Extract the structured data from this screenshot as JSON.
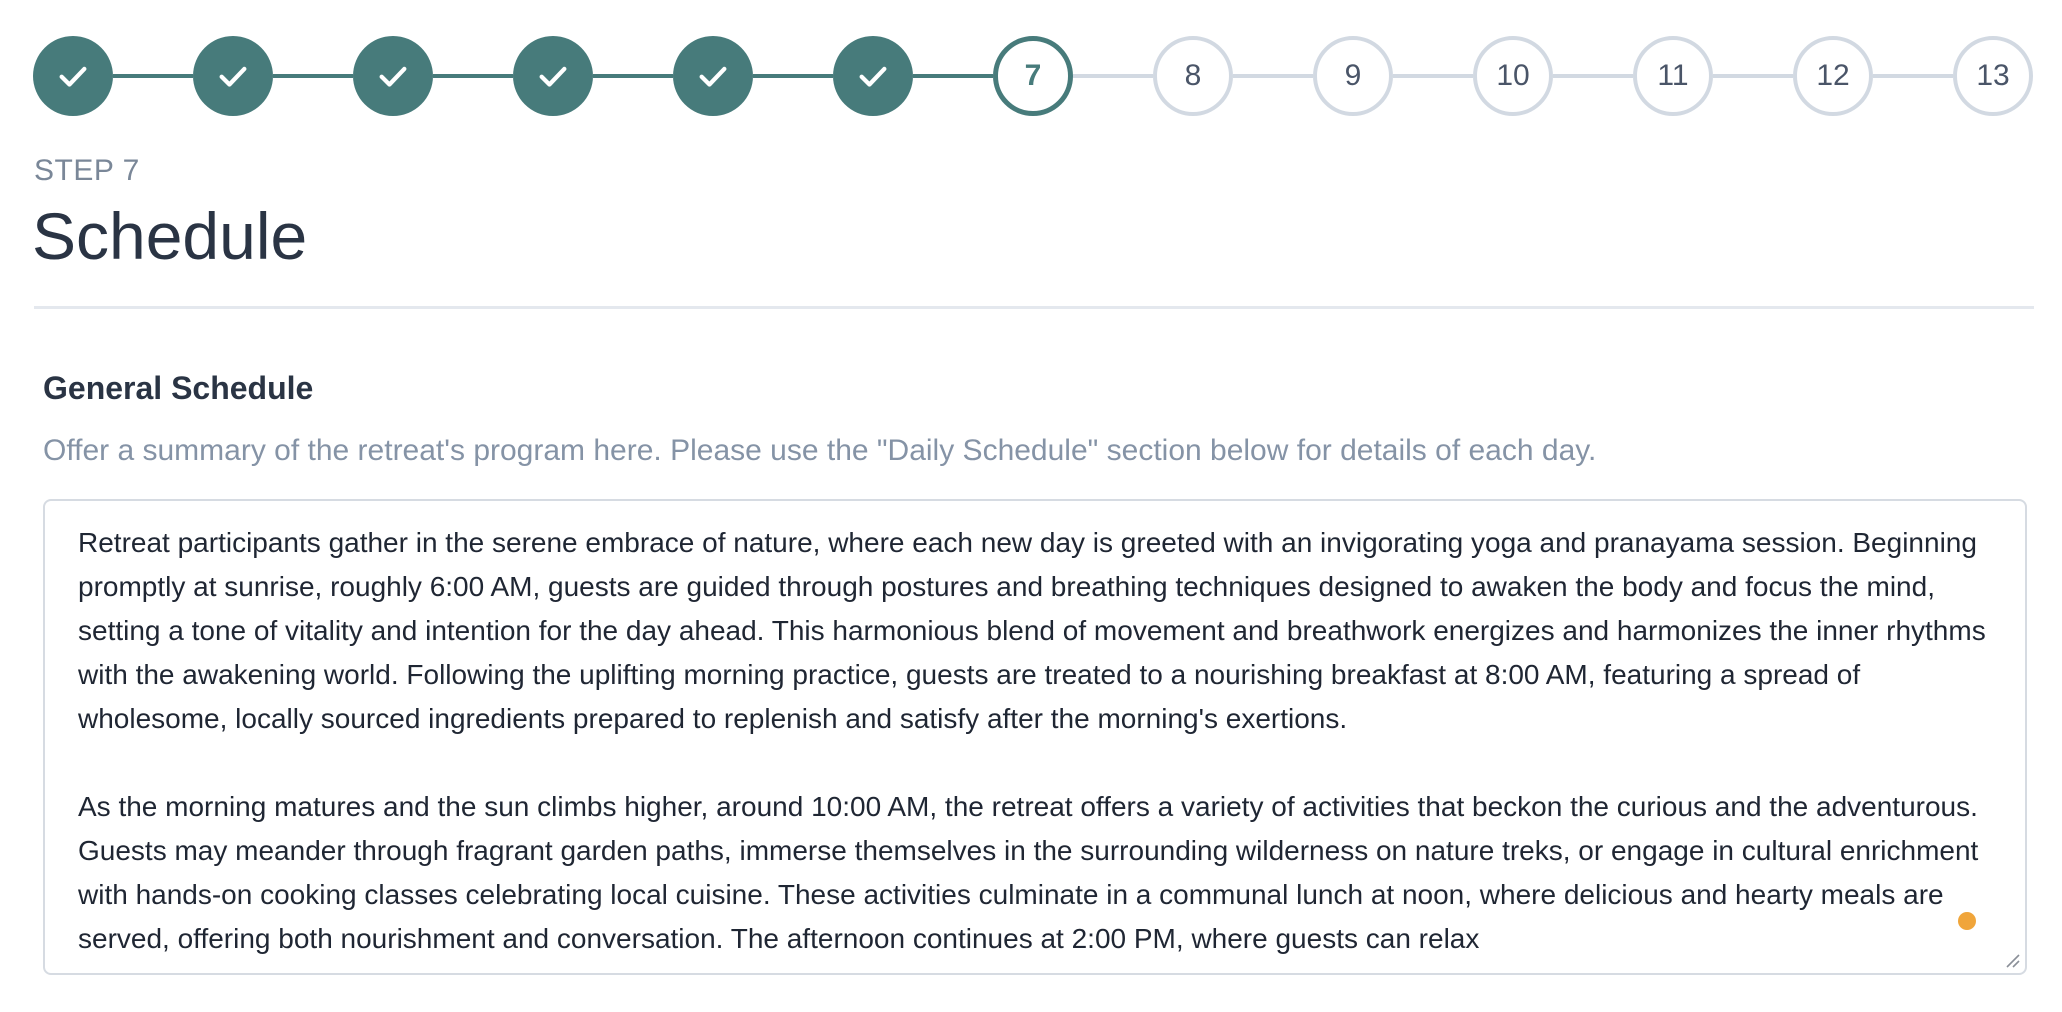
{
  "stepper": {
    "current_step": 7,
    "steps": [
      {
        "label": "",
        "status": "done",
        "icon": "check-icon"
      },
      {
        "label": "",
        "status": "done",
        "icon": "check-icon"
      },
      {
        "label": "",
        "status": "done",
        "icon": "check-icon"
      },
      {
        "label": "",
        "status": "done",
        "icon": "check-icon"
      },
      {
        "label": "",
        "status": "done",
        "icon": "check-icon"
      },
      {
        "label": "",
        "status": "done",
        "icon": "check-icon"
      },
      {
        "label": "7",
        "status": "current"
      },
      {
        "label": "8",
        "status": "todo"
      },
      {
        "label": "9",
        "status": "todo"
      },
      {
        "label": "10",
        "status": "todo"
      },
      {
        "label": "11",
        "status": "todo"
      },
      {
        "label": "12",
        "status": "todo"
      },
      {
        "label": "13",
        "status": "todo"
      }
    ],
    "colors": {
      "done": "#477b7b",
      "todo": "#d2d9e2"
    }
  },
  "header": {
    "kicker": "STEP 7",
    "title": "Schedule"
  },
  "general_schedule": {
    "label": "General Schedule",
    "help": "Offer a summary of the retreat's program here. Please use the \"Daily Schedule\" section below for details of each day.",
    "paragraphs": [
      "Retreat participants gather in the serene embrace of nature, where each new day is greeted with an invigorating yoga and pranayama session. Beginning promptly at sunrise, roughly 6:00 AM, guests are guided through postures and breathing techniques designed to awaken the body and focus the mind, setting a tone of vitality and intention for the day ahead. This harmonious blend of movement and breathwork energizes and harmonizes the inner rhythms with the awakening world. Following the uplifting morning practice, guests are treated to a nourishing breakfast at 8:00 AM, featuring a spread of wholesome, locally sourced ingredients prepared to replenish and satisfy after the morning's exertions.",
      "As the morning matures and the sun climbs higher, around 10:00 AM, the retreat offers a variety of activities that beckon the curious and the adventurous. Guests may meander through fragrant garden paths, immerse themselves in the surrounding wilderness on nature treks, or engage in cultural enrichment with hands-on cooking classes celebrating local cuisine. These activities culminate in a communal lunch at noon, where delicious and hearty meals are served, offering both nourishment and conversation. The afternoon continues at 2:00 PM, where guests can relax"
    ]
  }
}
